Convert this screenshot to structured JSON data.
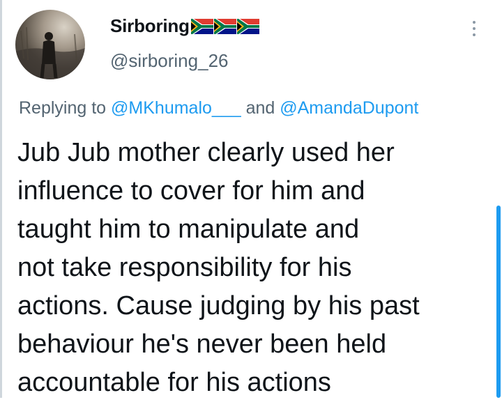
{
  "tweet": {
    "display_name": "Sirboring",
    "flags": [
      {
        "icon": "south-africa-flag-icon"
      },
      {
        "icon": "south-africa-flag-icon"
      },
      {
        "icon": "south-africa-flag-icon"
      }
    ],
    "handle": "@sirboring_26",
    "more_icon": "vertical-ellipsis-icon",
    "reply": {
      "prefix": "Replying to",
      "mention_1": "@MKhumalo___",
      "conjunction": "and",
      "mention_2": "@AmandaDupont"
    },
    "text_lines": [
      "Jub Jub mother clearly used her",
      "influence to cover for him and",
      "taught him to manipulate and",
      "not take responsibility for his",
      "actions. Cause judging by his past",
      "behaviour he's never been held",
      "accountable for his actions"
    ]
  },
  "colors": {
    "text": "#0f1419",
    "secondary": "#536471",
    "accent": "#1d9bf0",
    "flag_green": "#007749",
    "flag_red": "#e03c31",
    "flag_blue": "#001489",
    "flag_gold": "#ffb81c"
  }
}
